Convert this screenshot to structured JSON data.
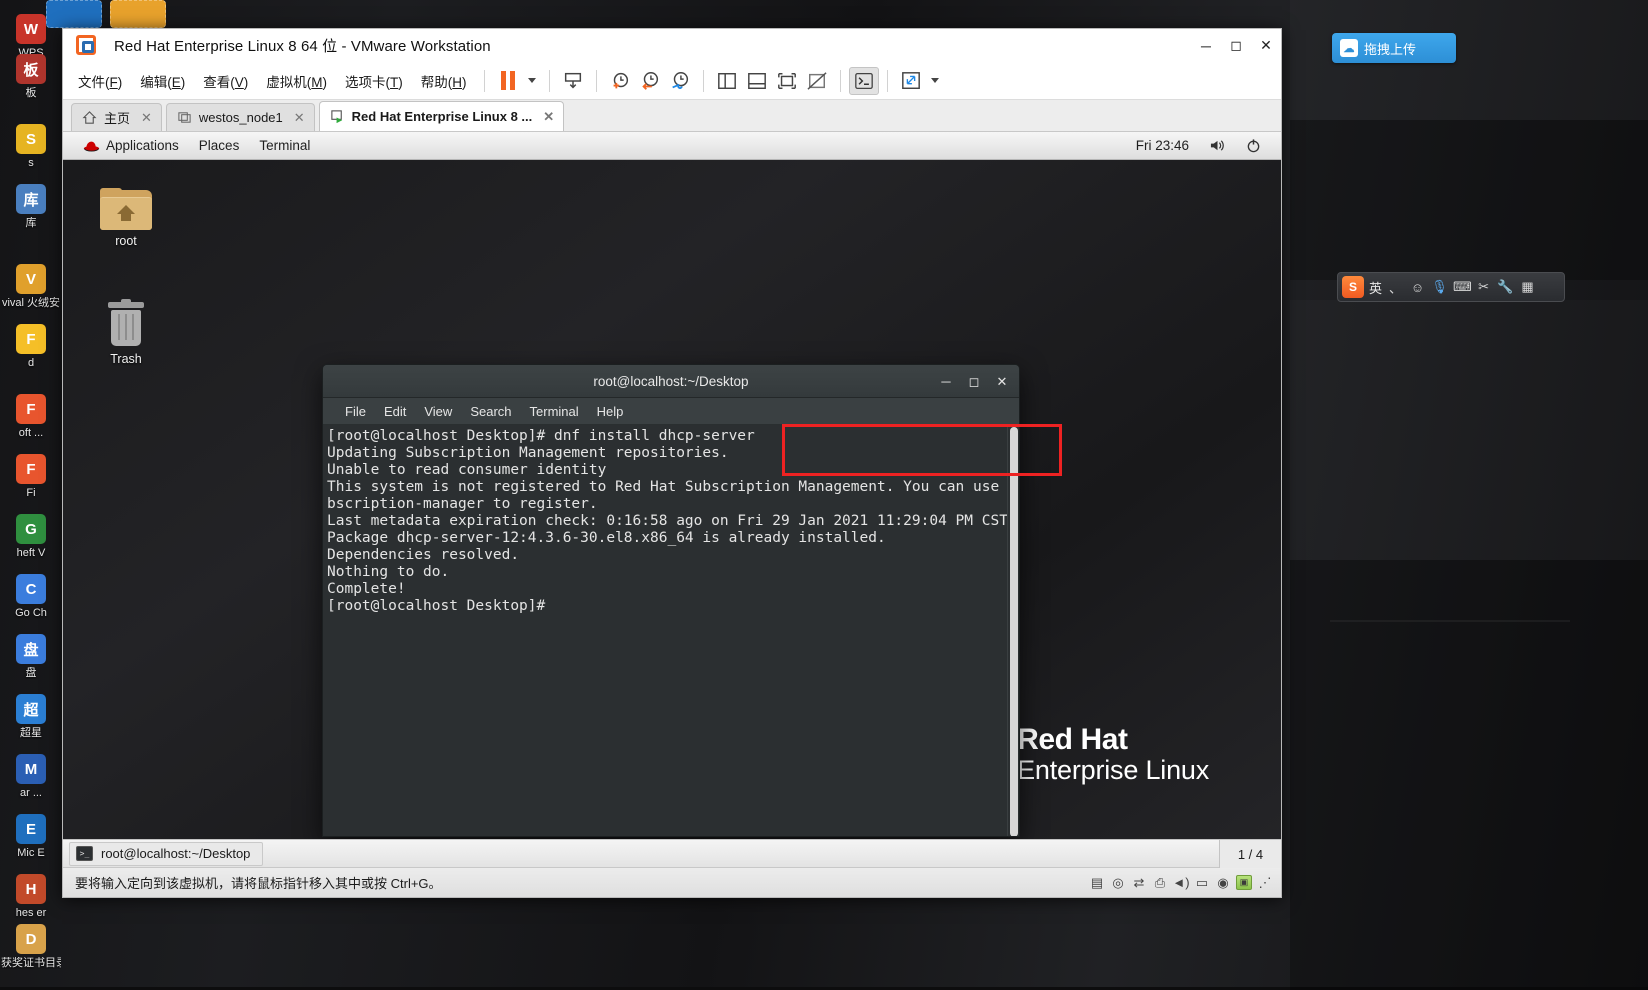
{
  "desktop": {
    "icons": [
      {
        "label": "WPS",
        "glyph": "W",
        "color": "#c8342a"
      },
      {
        "label": "板",
        "glyph": "板",
        "color": "#b0352d"
      },
      {
        "label": "s",
        "glyph": "S",
        "color": "#e6b422"
      },
      {
        "label": "库",
        "glyph": "库",
        "color": "#4a7fbf"
      },
      {
        "label": "vival 火绒安",
        "glyph": "V",
        "color": "#e0a02c"
      },
      {
        "label": "d",
        "glyph": "F",
        "color": "#f5bf27"
      },
      {
        "label": "oft ...",
        "glyph": "F",
        "color": "#e8552e"
      },
      {
        "label": "Fi",
        "glyph": "F",
        "color": "#e8552e"
      },
      {
        "label": "heft V",
        "glyph": "G",
        "color": "#2f8f3f"
      },
      {
        "label": "Go Ch",
        "glyph": "C",
        "color": "#3b7ddd"
      },
      {
        "label": "盘",
        "glyph": "盘",
        "color": "#3b7ddd"
      },
      {
        "label": "超星",
        "glyph": "超",
        "color": "#2b7fd4"
      },
      {
        "label": "ar ...",
        "glyph": "M",
        "color": "#2b5fb4"
      },
      {
        "label": "Mic E",
        "glyph": "E",
        "color": "#1f6fbe"
      },
      {
        "label": "hes er",
        "glyph": "H",
        "color": "#c24a2a"
      },
      {
        "label": "获奖证书目录",
        "glyph": "D",
        "color": "#d8a24a"
      }
    ],
    "upload_pill": {
      "icon": "cloud-upload-icon",
      "label": "拖拽上传"
    },
    "ime": {
      "logo": "S",
      "mode": "英",
      "items": [
        "，",
        "☺",
        "🎤",
        "⌨",
        "✂",
        "🔧",
        "▦"
      ]
    }
  },
  "vmware": {
    "title": "Red Hat Enterprise Linux 8 64 位 - VMware Workstation",
    "logo_icon": "vmware-logo-icon",
    "window_buttons": [
      {
        "name": "minimize",
        "glyph": "—"
      },
      {
        "name": "maximize",
        "glyph": "▢"
      },
      {
        "name": "close",
        "glyph": "✕"
      }
    ],
    "menus": [
      {
        "label": "文件(",
        "key": "F",
        "close": ")"
      },
      {
        "label": "编辑(",
        "key": "E",
        "close": ")"
      },
      {
        "label": "查看(",
        "key": "V",
        "close": ")"
      },
      {
        "label": "虚拟机(",
        "key": "M",
        "close": ")"
      },
      {
        "label": "选项卡(",
        "key": "T",
        "close": ")"
      },
      {
        "label": "帮助(",
        "key": "H",
        "close": ")"
      }
    ],
    "toolbar": [
      {
        "name": "suspend-pause-button",
        "icon": "pause-icon"
      },
      {
        "name": "power-dropdown-button",
        "icon": "chevron-down-icon"
      },
      {
        "name": "snapshot-take-button",
        "icon": "snapshot-icon"
      },
      {
        "name": "snapshot-add-button",
        "icon": "clock-plus-icon"
      },
      {
        "name": "snapshot-revert-button",
        "icon": "clock-back-icon"
      },
      {
        "name": "snapshot-manager-button",
        "icon": "clock-wrench-icon"
      },
      {
        "name": "show-library-button",
        "icon": "panel-left-icon"
      },
      {
        "name": "show-thumbnail-button",
        "icon": "panel-bottom-icon"
      },
      {
        "name": "show-console-button",
        "icon": "fullscreen-icon"
      },
      {
        "name": "hide-preview-button",
        "icon": "panel-off-icon"
      },
      {
        "name": "unity-console-button",
        "icon": "terminal-prompt-icon"
      },
      {
        "name": "fullscreen-button",
        "icon": "expand-arrows-icon"
      },
      {
        "name": "fullscreen-dropdown-button",
        "icon": "chevron-down-icon"
      }
    ],
    "tabs": [
      {
        "label": "主页",
        "icon": "home-icon",
        "active": false,
        "closable": true
      },
      {
        "label": "westos_node1",
        "icon": "vm-icon",
        "active": false,
        "closable": true
      },
      {
        "label": "Red Hat Enterprise Linux 8 ...",
        "icon": "vm-running-icon",
        "active": true,
        "closable": true
      }
    ],
    "taskbar": {
      "task_label": "root@localhost:~/Desktop",
      "task_icon": "terminal-icon",
      "page_count": "1 / 4"
    },
    "statusbar": {
      "message": "要将输入定向到该虚拟机，请将鼠标指针移入其中或按 Ctrl+G。",
      "icons": [
        {
          "name": "hdd-status-icon",
          "glyph": "▤",
          "style": "plain"
        },
        {
          "name": "cd-status-icon",
          "glyph": "◎",
          "style": "plain"
        },
        {
          "name": "network-status-icon",
          "glyph": "⇄",
          "style": "plain"
        },
        {
          "name": "printer-status-icon",
          "glyph": "⎙",
          "style": "plain"
        },
        {
          "name": "sound-status-icon",
          "glyph": "🔊",
          "style": "plain"
        },
        {
          "name": "usb-status-icon",
          "glyph": "▭",
          "style": "plain"
        },
        {
          "name": "camera-status-icon",
          "glyph": "◉",
          "style": "plain"
        },
        {
          "name": "message-status-icon",
          "glyph": "▣",
          "style": "green"
        },
        {
          "name": "resize-grip-icon",
          "glyph": "⋰",
          "style": "plain"
        }
      ]
    }
  },
  "guest": {
    "gnome_panel": {
      "applications": "Applications",
      "places": "Places",
      "terminal": "Terminal",
      "clock": "Fri 23:46",
      "volume_icon": "speaker-icon",
      "power_icon": "power-icon",
      "hat_icon": "redhat-hat-icon"
    },
    "desktop_icons": [
      {
        "label": "root",
        "icon": "folder-home-icon"
      },
      {
        "label": "Trash",
        "icon": "trash-icon"
      }
    ],
    "branding": {
      "line1": "Red Hat",
      "line2": "Enterprise Linux",
      "logo_icon": "redhat-fedora-logo-icon"
    }
  },
  "terminal": {
    "title": "root@localhost:~/Desktop",
    "window_buttons": [
      {
        "name": "minimize",
        "glyph": "—"
      },
      {
        "name": "maximize",
        "glyph": "▢"
      },
      {
        "name": "close",
        "glyph": "✕"
      }
    ],
    "menus": [
      "File",
      "Edit",
      "View",
      "Search",
      "Terminal",
      "Help"
    ],
    "content": "[root@localhost Desktop]# dnf install dhcp-server\nUpdating Subscription Management repositories.\nUnable to read consumer identity\nThis system is not registered to Red Hat Subscription Management. You can use su\nbscription-manager to register.\nLast metadata expiration check: 0:16:58 ago on Fri 29 Jan 2021 11:29:04 PM CST.\nPackage dhcp-server-12:4.3.6-30.el8.x86_64 is already installed.\nDependencies resolved.\nNothing to do.\nComplete!\n[root@localhost Desktop]# ",
    "annotation": {
      "name": "red-highlight-box",
      "color": "#ee2222"
    }
  }
}
